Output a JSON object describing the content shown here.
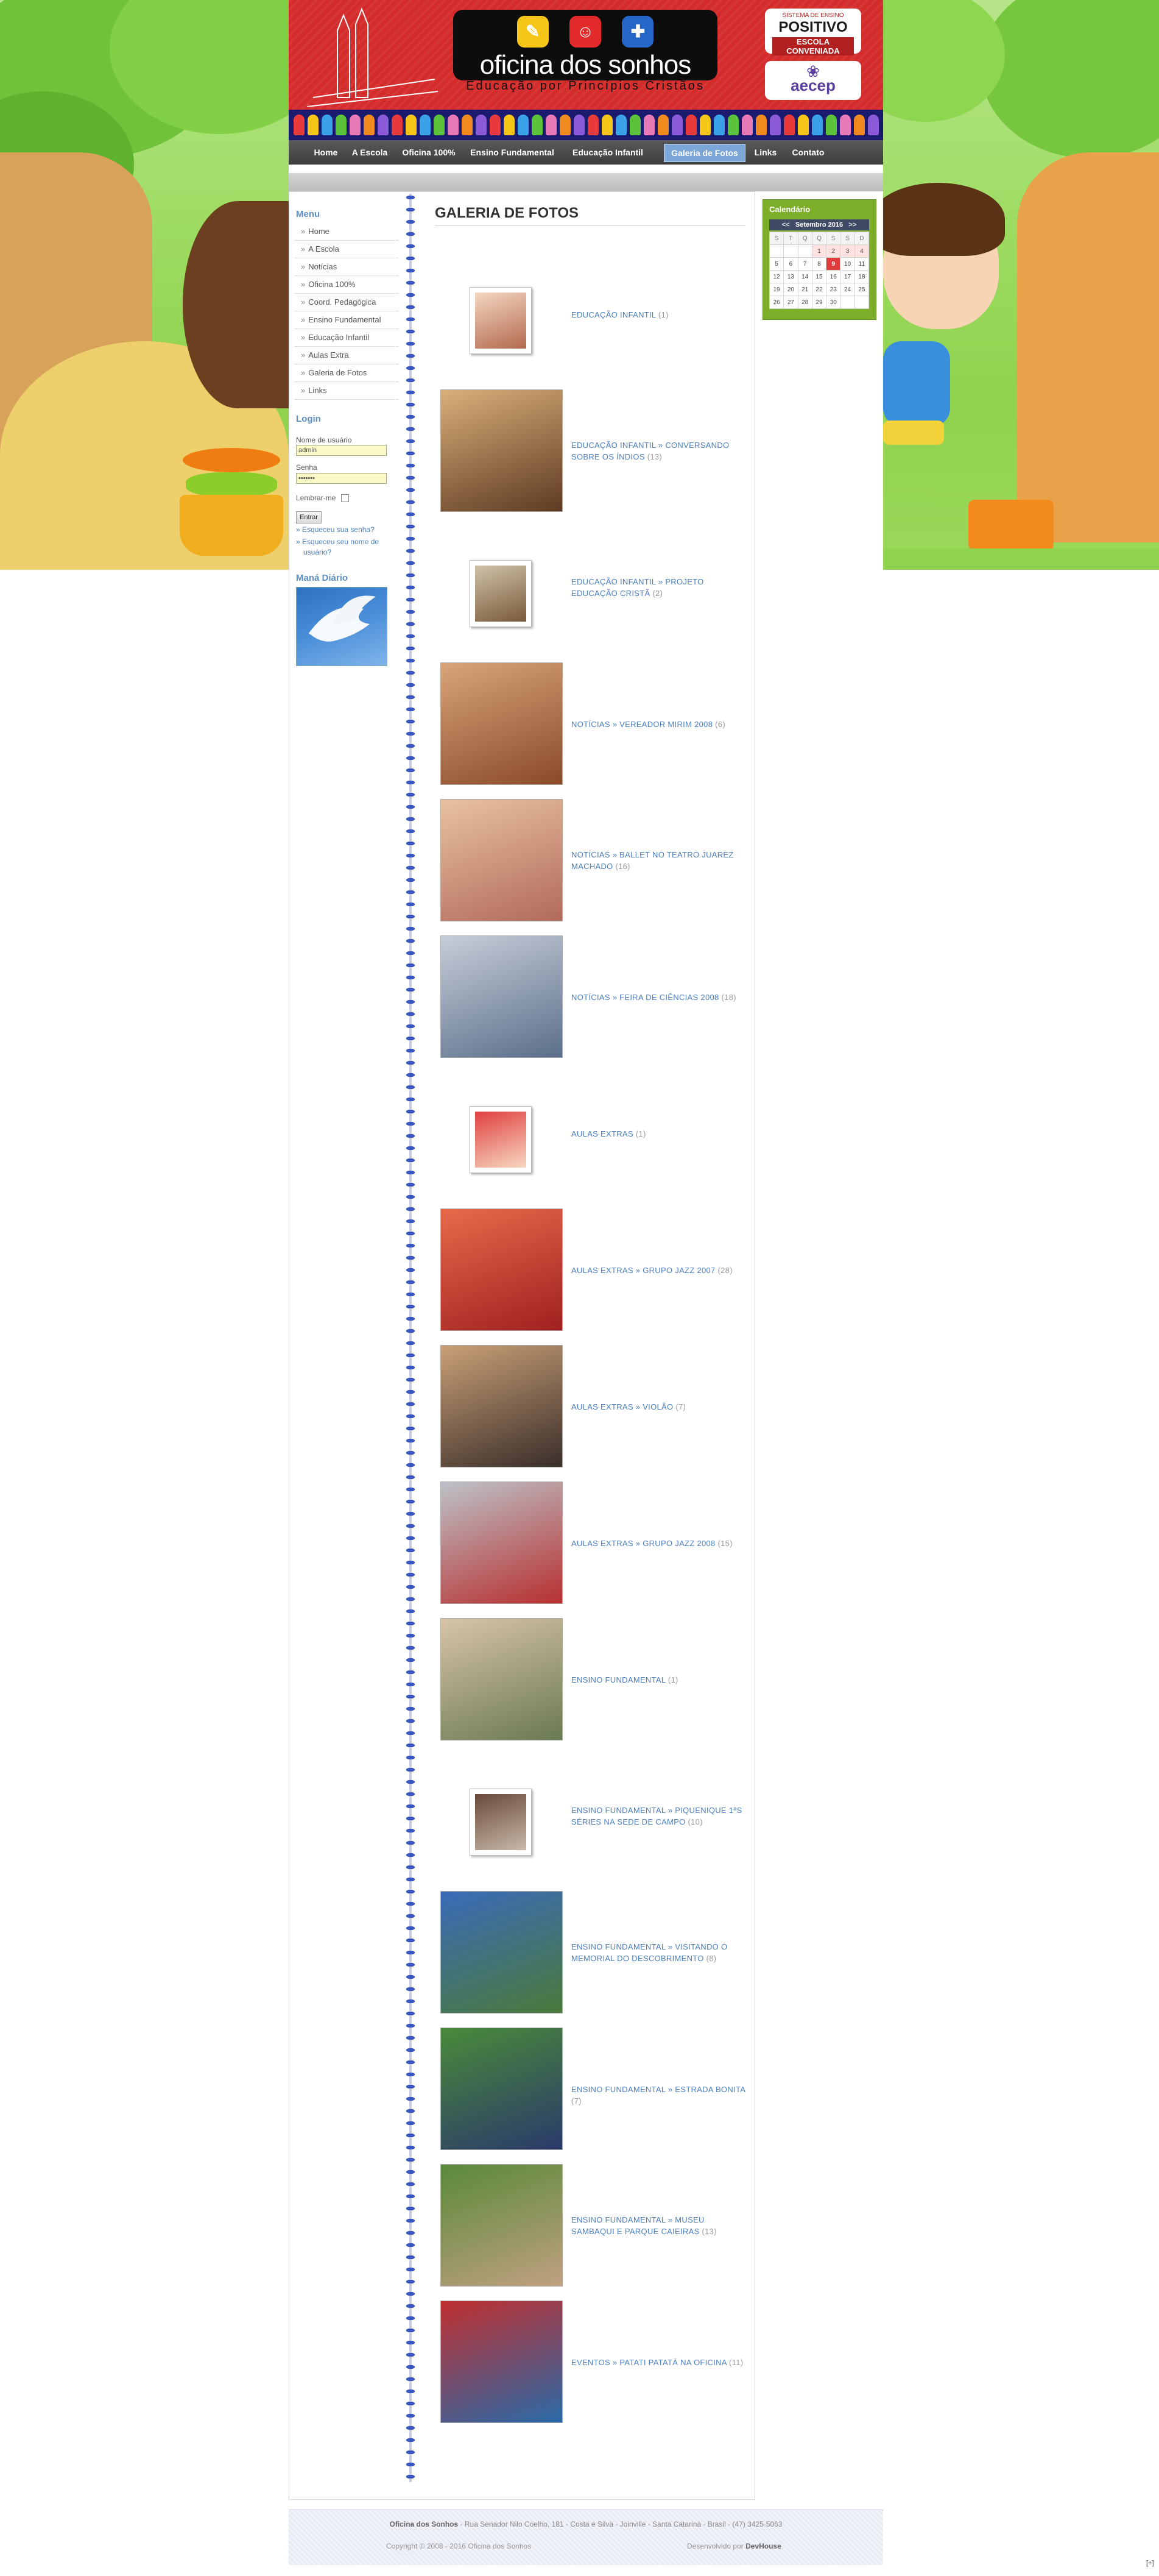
{
  "header": {
    "brand_name": "oficina dos sonhos",
    "brand_tagline": "Educação por Princípios Cristãos",
    "logo_positivo_top": "SISTEMA DE ENSINO",
    "logo_positivo_name": "POSITIVO",
    "logo_positivo_sub": "ESCOLA CONVENIADA",
    "logo_aecep": "aecep"
  },
  "nav": {
    "items": [
      "Home",
      "A Escola",
      "Oficina 100%",
      "Ensino Fundamental",
      "Educação Infantil",
      "Galeria de Fotos",
      "Links",
      "Contato"
    ],
    "active": "Galeria de Fotos"
  },
  "sidebar": {
    "menu_title": "Menu",
    "menu_items": [
      "Home",
      "A Escola",
      "Notícias",
      "Oficina 100%",
      "Coord. Pedagógica",
      "Ensino Fundamental",
      "Educação Infantil",
      "Aulas Extra",
      "Galeria de Fotos",
      "Links"
    ],
    "login_title": "Login",
    "username_label": "Nome de usuário",
    "username_value": "admin",
    "password_label": "Senha",
    "password_value": "•••••••",
    "remember_label": "Lembrar-me",
    "submit_label": "Entrar",
    "forgot_password": "Esqueceu sua senha?",
    "forgot_username": "Esqueceu seu nome de usuário?",
    "forgot_username_l1": "Esqueceu seu nome de",
    "forgot_username_l2": "usuário?",
    "mana_title": "Maná Diário"
  },
  "gallery": {
    "title": "GALERIA DE FOTOS",
    "items": [
      {
        "label": "EDUCAÇÃO INFANTIL",
        "count": "(1)"
      },
      {
        "label": "EDUCAÇÃO INFANTIL » CONVERSANDO SOBRE OS ÍNDIOS",
        "count": "(13)"
      },
      {
        "label": "EDUCAÇÃO INFANTIL » PROJETO EDUCAÇÃO CRISTÃ",
        "count": "(2)"
      },
      {
        "label": "NOTÍCIAS » VEREADOR MIRIM 2008",
        "count": "(6)"
      },
      {
        "label": "NOTÍCIAS » BALLET NO TEATRO JUAREZ MACHADO",
        "count": "(16)"
      },
      {
        "label": "NOTÍCIAS » FEIRA DE CIÊNCIAS 2008",
        "count": "(18)"
      },
      {
        "label": "AULAS EXTRAS",
        "count": "(1)"
      },
      {
        "label": "AULAS EXTRAS » GRUPO JAZZ 2007",
        "count": "(28)"
      },
      {
        "label": "AULAS EXTRAS » VIOLÃO",
        "count": "(7)"
      },
      {
        "label": "AULAS EXTRAS » GRUPO JAZZ 2008",
        "count": "(15)"
      },
      {
        "label": "ENSINO FUNDAMENTAL",
        "count": "(1)"
      },
      {
        "label": "ENSINO FUNDAMENTAL » PIQUENIQUE 1ªS SÉRIES NA SEDE DE CAMPO",
        "count": "(10)"
      },
      {
        "label": "ENSINO FUNDAMENTAL » VISITANDO O MEMORIAL DO DESCOBRIMENTO",
        "count": "(8)"
      },
      {
        "label": "ENSINO FUNDAMENTAL » ESTRADA BONITA",
        "count": "(7)"
      },
      {
        "label": "ENSINO FUNDAMENTAL » MUSEU SAMBAQUI E PARQUE CAIEIRAS",
        "count": "(13)"
      },
      {
        "label": "EVENTOS » PATATI PATATÁ NA OFICINA",
        "count": "(11)"
      }
    ]
  },
  "calendar": {
    "title": "Calendário",
    "prev": "<<",
    "month": "Setembro 2016",
    "next": ">>",
    "weekdays": [
      "S",
      "T",
      "Q",
      "Q",
      "S",
      "S",
      "D"
    ],
    "weeks": [
      [
        "",
        "",
        "",
        "1",
        "2",
        "3",
        "4"
      ],
      [
        "5",
        "6",
        "7",
        "8",
        "9",
        "10",
        "11"
      ],
      [
        "12",
        "13",
        "14",
        "15",
        "16",
        "17",
        "18"
      ],
      [
        "19",
        "20",
        "21",
        "22",
        "23",
        "24",
        "25"
      ],
      [
        "26",
        "27",
        "28",
        "29",
        "30",
        "",
        ""
      ]
    ],
    "today": "9"
  },
  "footer": {
    "school": "Oficina dos Sonhos",
    "address": " - Rua Senador Nilo Coelho, 181 - Costa e Silva - Joinville - Santa Catarina - Brasil - (47) 3425-5063",
    "copyright": "Copyright © 2008 - 2016 Oficina dos Sonhos",
    "developed_by_label": "Desenvolvido por ",
    "developer": "DevHouse"
  },
  "corner_mark": "[+]",
  "colors": {
    "header_red": "#d42b2b",
    "nav_active": "#7aa6d8",
    "link_blue": "#4b7fbf",
    "calendar_green": "#7cae2a",
    "today_red": "#e03a3a"
  }
}
